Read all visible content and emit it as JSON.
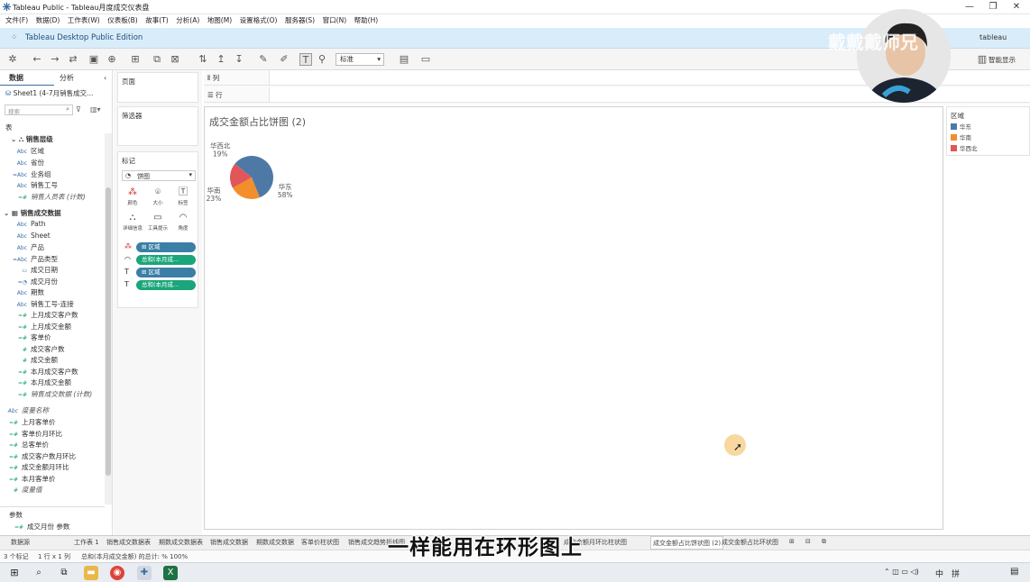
{
  "window": {
    "title": "Tableau Public - Tableau月度成交仪表盘",
    "minimize": "—",
    "maximize": "❐",
    "close": "✕"
  },
  "menu": [
    "文件(F)",
    "数据(D)",
    "工作表(W)",
    "仪表板(B)",
    "故事(T)",
    "分析(A)",
    "地图(M)",
    "设置格式(O)",
    "服务器(S)",
    "窗口(N)",
    "帮助(H)"
  ],
  "edition": {
    "label": "Tableau Desktop Public Edition",
    "brand": "tableau",
    "smart_show": "智能显示"
  },
  "toolbar": {
    "fit_select": "标准"
  },
  "sidebar": {
    "tab_data": "数据",
    "tab_analysis": "分析",
    "datasource": "Sheet1 (4-7月销售成交...",
    "search_placeholder": "搜索",
    "table_header": "表",
    "group1": "销售层级",
    "group1_fields": [
      "区域",
      "省份",
      "业务组",
      "销售工号"
    ],
    "group1_calc": "销售人员表 (计数)",
    "group2": "销售成交数据",
    "group2_fields": [
      "Path",
      "Sheet",
      "产品",
      "产品类型",
      "成交日期",
      "成交月份",
      "期数",
      "销售工号-连接",
      "上月成交客户数",
      "上月成交金额",
      "客单价",
      "成交客户数",
      "成交金额",
      "本月成交客户数",
      "本月成交金额"
    ],
    "group2_calc": "销售成交数据 (计数)",
    "measure_name": "度量名称",
    "calc_fields": [
      "上月客单价",
      "客单价月环比",
      "总客单价",
      "成交客户数月环比",
      "成交金额月环比",
      "本月客单价",
      "度量值"
    ],
    "params_header": "参数",
    "params": [
      "成交月份 参数"
    ]
  },
  "cards": {
    "pages": "页面",
    "filters": "筛选器",
    "marks": "标记",
    "mark_type": "饼图",
    "mark_buttons": [
      "颜色",
      "大小",
      "标签",
      "详细信息",
      "工具提示",
      "角度"
    ],
    "pills": [
      "区域",
      "总和(本月成...",
      "区域",
      "总和(本月成..."
    ]
  },
  "shelves": {
    "columns": "列",
    "rows": "行"
  },
  "viz": {
    "title": "成交金额占比饼图 (2)"
  },
  "chart_data": {
    "type": "pie",
    "title": "成交金额占比饼图 (2)",
    "categories": [
      "华东",
      "华南",
      "华西北"
    ],
    "values": [
      58,
      23,
      19
    ],
    "labels": [
      "华东\n58%",
      "华南\n23%",
      "华西北\n19%"
    ],
    "colors": [
      "#4e79a7",
      "#f28e2b",
      "#e15759"
    ]
  },
  "legend": {
    "title": "区域",
    "items": [
      "华东",
      "华南",
      "华西北"
    ]
  },
  "sheet_tabs": [
    "数据源",
    "工作表 1",
    "销售成交数据表",
    "期数成交数据表",
    "销售成交数据",
    "期数成交数据",
    "客单价柱状图",
    "销售成交趋势折线图",
    "成交金额月环比柱状图",
    "成交金额占比饼状图 (2)",
    "成交金额占比环状图"
  ],
  "status": {
    "marks": "3 个标记",
    "rows": "1 行 x 1 列",
    "sum": "总和(本月成交金额) 的总计: % 100%"
  },
  "taskbar": {
    "ime": "中",
    "clock": "拼"
  },
  "overlay": {
    "subtitle": "一样能用在环形图上",
    "watermark": "戴戴戴师兄"
  }
}
